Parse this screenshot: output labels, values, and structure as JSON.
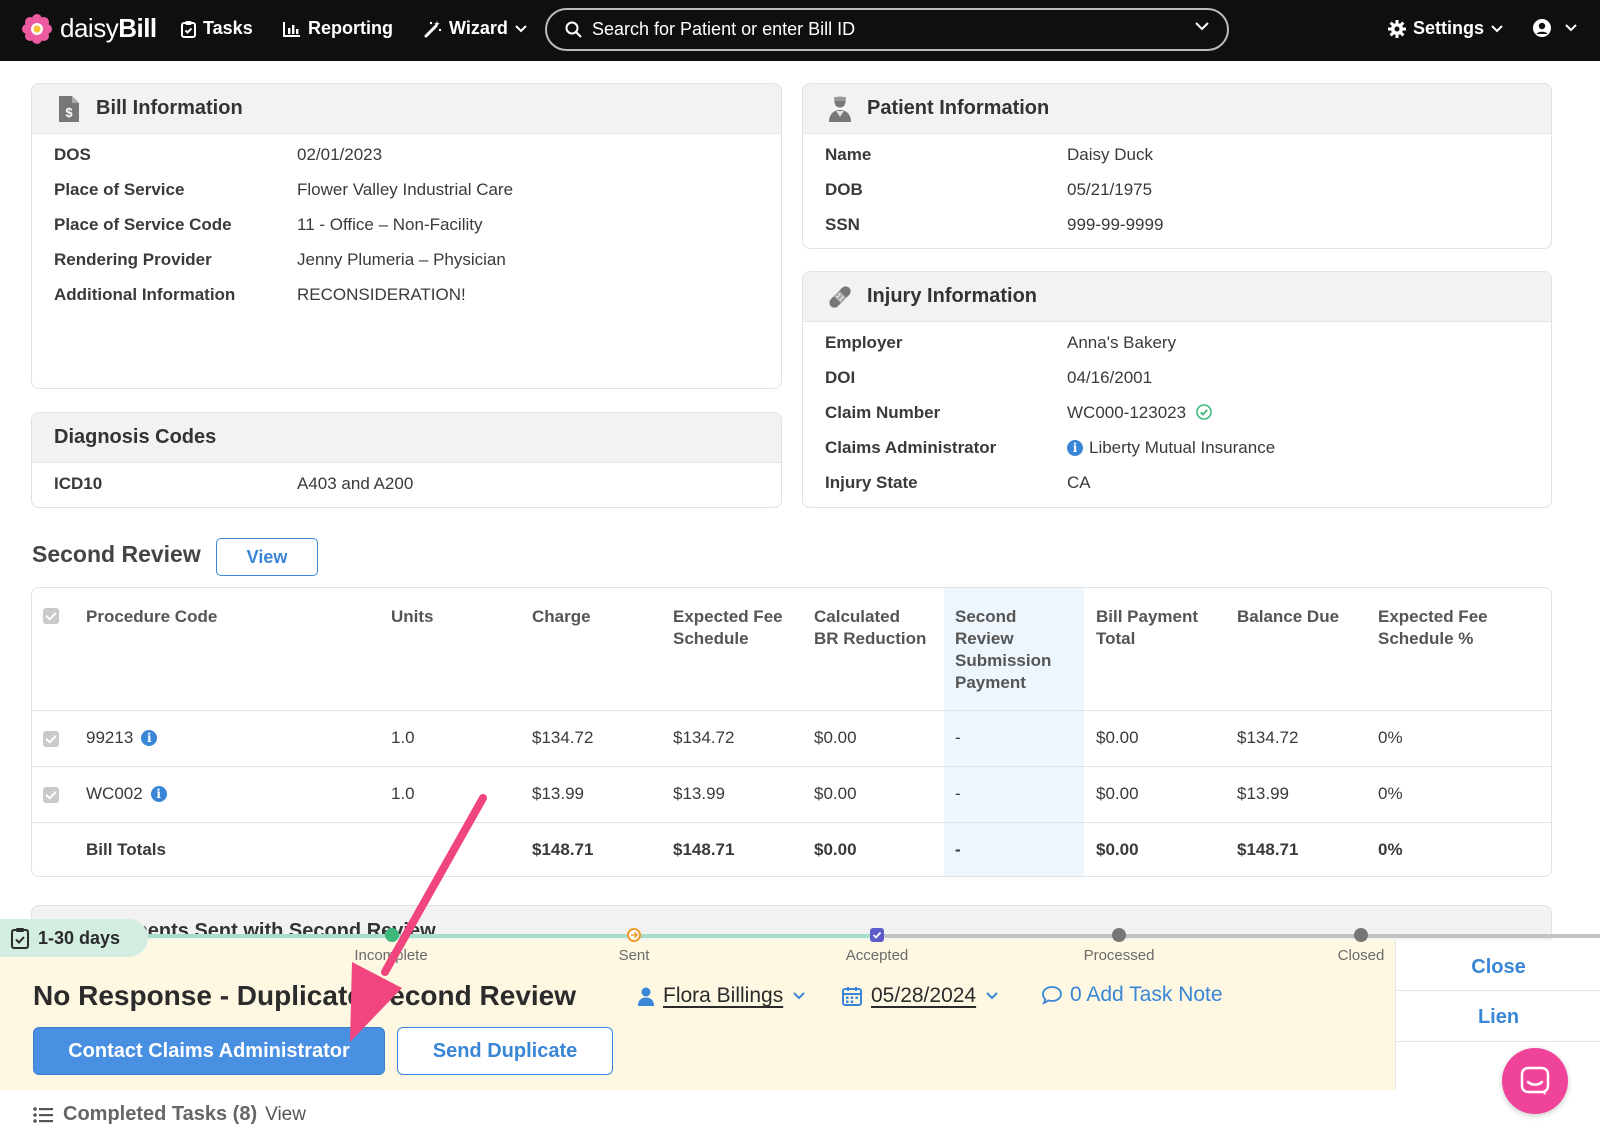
{
  "nav": {
    "brand_light": "daisy",
    "brand_bold": "Bill",
    "tasks": "Tasks",
    "reporting": "Reporting",
    "wizard": "Wizard",
    "search_placeholder": "Search for Patient or enter Bill ID",
    "settings": "Settings"
  },
  "bill_info": {
    "title": "Bill Information",
    "rows": [
      {
        "label": "DOS",
        "value": "02/01/2023"
      },
      {
        "label": "Place of Service",
        "value": "Flower Valley Industrial Care"
      },
      {
        "label": "Place of Service Code",
        "value": "11 - Office – Non-Facility"
      },
      {
        "label": "Rendering Provider",
        "value": "Jenny Plumeria – Physician"
      },
      {
        "label": "Additional Information",
        "value": "RECONSIDERATION!"
      }
    ]
  },
  "patient_info": {
    "title": "Patient Information",
    "rows": [
      {
        "label": "Name",
        "value": "Daisy Duck"
      },
      {
        "label": "DOB",
        "value": "05/21/1975"
      },
      {
        "label": "SSN",
        "value": "999-99-9999"
      }
    ]
  },
  "injury_info": {
    "title": "Injury Information",
    "rows": [
      {
        "label": "Employer",
        "value": "Anna's Bakery"
      },
      {
        "label": "DOI",
        "value": "04/16/2001"
      },
      {
        "label": "Claim Number",
        "value": "WC000-123023"
      },
      {
        "label": "Claims Administrator",
        "value": "Liberty Mutual Insurance"
      },
      {
        "label": "Injury State",
        "value": "CA"
      }
    ]
  },
  "diagnosis": {
    "title": "Diagnosis Codes",
    "label": "ICD10",
    "value": "A403 and A200"
  },
  "second_review": {
    "title": "Second Review",
    "view_label": "View",
    "headers": {
      "procedure": "Procedure Code",
      "units": "Units",
      "charge": "Charge",
      "efs_1": "Expected Fee",
      "efs_2": "Schedule",
      "cbr_1": "Calculated",
      "cbr_2": "BR Reduction",
      "srs_1": "Second",
      "srs_2": "Review",
      "srs_3": "Submission",
      "srs_4": "Payment",
      "bpt_1": "Bill Payment",
      "bpt_2": "Total",
      "balance": "Balance Due",
      "efsp_1": "Expected Fee",
      "efsp_2": "Schedule %"
    },
    "rows": [
      {
        "code": "99213",
        "units": "1.0",
        "charge": "$134.72",
        "efs": "$134.72",
        "cbr": "$0.00",
        "srs": "-",
        "bpt": "$0.00",
        "balance": "$134.72",
        "pct": "0%"
      },
      {
        "code": "WC002",
        "units": "1.0",
        "charge": "$13.99",
        "efs": "$13.99",
        "cbr": "$0.00",
        "srs": "-",
        "bpt": "$0.00",
        "balance": "$13.99",
        "pct": "0%"
      }
    ],
    "totals": {
      "label": "Bill Totals",
      "charge": "$148.71",
      "efs": "$148.71",
      "cbr": "$0.00",
      "srs": "-",
      "bpt": "$0.00",
      "balance": "$148.71",
      "pct": "0%"
    }
  },
  "docs_card_title": "Documents Sent with Second Review",
  "task": {
    "days": "1-30 days",
    "steps": [
      "Incomplete",
      "Sent",
      "Accepted",
      "Processed",
      "Closed"
    ],
    "title": "No Response - Duplicate Second Review",
    "assignee": "Flora Billings",
    "due_date": "05/28/2024",
    "note": "0 Add Task Note",
    "primary_btn": "Contact Claims Administrator",
    "secondary_btn": "Send Duplicate",
    "side_close": "Close",
    "side_lien": "Lien"
  },
  "completed": {
    "label": "Completed Tasks (8)",
    "view": "View"
  },
  "colors": {
    "accent": "#3a86d6",
    "brand_pink": "#f0449a",
    "task_bg": "#fef7e2",
    "badge_bg": "#d3eee1",
    "progress_green": "#a7dfc6",
    "arrow": "#f0457e"
  }
}
